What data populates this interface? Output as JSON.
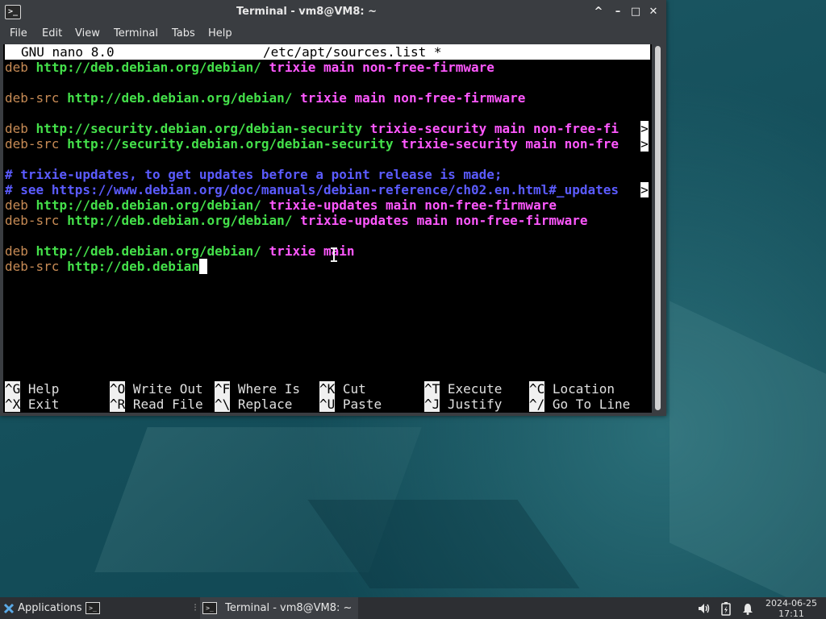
{
  "window": {
    "title": "Terminal - vm8@VM8: ~",
    "controls": {
      "up": "^",
      "minimize": "–",
      "maximize": "□",
      "close": "✕"
    }
  },
  "menu": [
    "File",
    "Edit",
    "View",
    "Terminal",
    "Tabs",
    "Help"
  ],
  "nano": {
    "version": "GNU nano 8.0",
    "filename": "/etc/apt/sources.list *"
  },
  "lines": [
    {
      "kw": "deb",
      "url": "http://deb.debian.org/debian/",
      "rest": "trixie main non-free-firmware"
    },
    {
      "kw": "deb-src",
      "url": "http://deb.debian.org/debian/",
      "rest": "trixie main non-free-firmware"
    },
    {
      "kw": "deb",
      "url": "http://security.debian.org/debian-security",
      "rest": "trixie-security main non-free-fi"
    },
    {
      "kw": "deb-src",
      "url": "http://security.debian.org/debian-security",
      "rest": "trixie-security main non-fre"
    },
    {
      "comment": "# trixie-updates, to get updates before a point release is made;"
    },
    {
      "comment": "# see https://www.debian.org/doc/manuals/debian-reference/ch02.en.html#_updates"
    },
    {
      "kw": "deb",
      "url": "http://deb.debian.org/debian/",
      "rest": "trixie-updates main non-free-firmware"
    },
    {
      "kw": "deb-src",
      "url": "http://deb.debian.org/debian/",
      "rest": "trixie-updates main non-free-firmware"
    },
    {
      "kw": "deb",
      "url": "http://deb.debian.org/debian/",
      "rest": "trixie main"
    },
    {
      "kw": "deb-src",
      "url": "http://deb.debian",
      "rest": ""
    }
  ],
  "truncation_marker": ">",
  "shortcuts": [
    {
      "key": "^G",
      "label": "Help"
    },
    {
      "key": "^O",
      "label": "Write Out"
    },
    {
      "key": "^F",
      "label": "Where Is"
    },
    {
      "key": "^K",
      "label": "Cut"
    },
    {
      "key": "^T",
      "label": "Execute"
    },
    {
      "key": "^C",
      "label": "Location"
    },
    {
      "key": "^X",
      "label": "Exit"
    },
    {
      "key": "^R",
      "label": "Read File"
    },
    {
      "key": "^\\",
      "label": "Replace"
    },
    {
      "key": "^U",
      "label": "Paste"
    },
    {
      "key": "^J",
      "label": "Justify"
    },
    {
      "key": "^/",
      "label": "Go To Line"
    }
  ],
  "taskbar": {
    "applications": "Applications",
    "task_label": "Terminal - vm8@VM8: ~",
    "date": "2024-06-25",
    "time": "17:11"
  },
  "colors": {
    "keyword": "#c78b55",
    "url": "#44e04a",
    "suite": "#ff58ff",
    "comment": "#5b5bff",
    "terminal_bg": "#000000",
    "chrome": "#3a3d41"
  },
  "icons": [
    "terminal-app-icon",
    "applications-logo-icon",
    "volume-icon",
    "battery-icon",
    "notification-bell-icon",
    "text-cursor-ibeam-icon"
  ]
}
